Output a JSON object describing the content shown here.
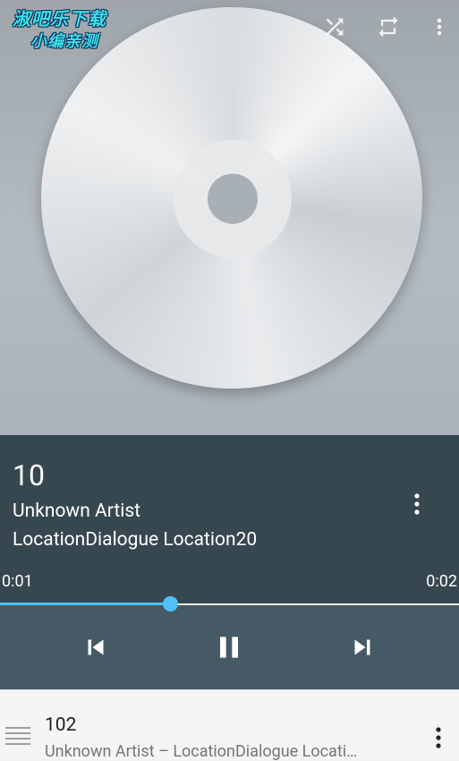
{
  "watermark": {
    "line1": "淑吧乐下载",
    "line2": "小编亲测"
  },
  "toolbar": {
    "icons": [
      "shuffle-icon",
      "repeat-icon",
      "more-vert-icon"
    ]
  },
  "album_art": {
    "icon": "cd-disc-placeholder"
  },
  "now_playing": {
    "title": "10",
    "artist": "Unknown Artist",
    "album": "LocationDialogue Location20",
    "menu_icon": "more-vert-icon"
  },
  "progress": {
    "current_time": "0:01",
    "duration": "0:02",
    "fraction": 0.37,
    "accent_color": "#4fc3f7"
  },
  "controls": {
    "icons": [
      "skip-previous-icon",
      "pause-icon",
      "skip-next-icon"
    ]
  },
  "queue": {
    "items": [
      {
        "title": "102",
        "subtitle": "Unknown Artist – LocationDialogue Locati…",
        "handle_icon": "drag-handle-icon",
        "menu_icon": "more-vert-icon"
      }
    ]
  },
  "colors": {
    "info_bg": "#37474f",
    "controls_bg": "#455a64",
    "queue_bg": "#f5f5f5"
  }
}
